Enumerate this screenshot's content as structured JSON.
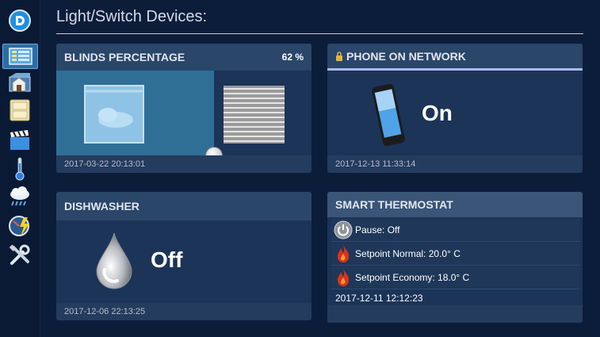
{
  "page": {
    "title": "Light/Switch Devices:"
  },
  "sidebar": {
    "items": [
      {
        "name": "dashboard",
        "icon": "dashboard-icon",
        "active": true
      },
      {
        "name": "floorplan",
        "icon": "house-icon"
      },
      {
        "name": "light-switches",
        "icon": "switch-panel-icon"
      },
      {
        "name": "scenes",
        "icon": "clapperboard-icon"
      },
      {
        "name": "temperature",
        "icon": "thermometer-icon"
      },
      {
        "name": "weather",
        "icon": "rain-cloud-icon"
      },
      {
        "name": "utility",
        "icon": "gauge-icon"
      },
      {
        "name": "setup",
        "icon": "tools-icon"
      }
    ]
  },
  "cards": {
    "blinds": {
      "title": "BLINDS PERCENTAGE",
      "value": "62 %",
      "level_percent": 62,
      "timestamp": "2017-03-22 20:13:01"
    },
    "phone": {
      "title": "PHONE ON NETWORK",
      "status": "On",
      "timestamp": "2017-12-13 11:33:14"
    },
    "dishwasher": {
      "title": "DISHWASHER",
      "status": "Off",
      "timestamp": "2017-12-06 22:13:25"
    },
    "thermostat": {
      "title": "SMART THERMOSTAT",
      "rows": [
        {
          "label": "Pause: Off",
          "icon": "power-icon"
        },
        {
          "label": "Setpoint Normal: 20.0° C",
          "icon": "flame-icon"
        },
        {
          "label": "Setpoint Economy: 18.0° C",
          "icon": "flame-icon"
        }
      ],
      "timestamp": "2017-12-11 12:12:23"
    }
  },
  "colors": {
    "background": "#0c1d3a",
    "card": "#1b3457",
    "card_header": "#2a4669",
    "accent_blue": "#2c6ea4",
    "phone_header_line": "#a9b9ee"
  }
}
